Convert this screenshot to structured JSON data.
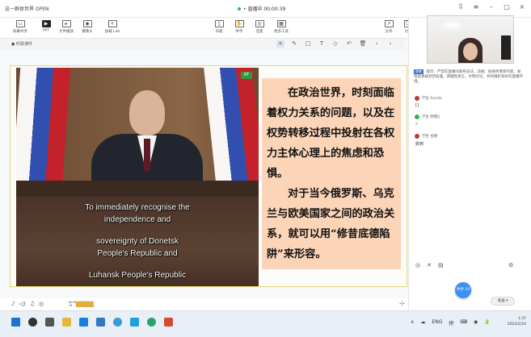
{
  "app": {
    "title": "这一群体世界 OPEN",
    "live_timer": "• 直播中 00:00:39"
  },
  "window_controls": {
    "layout_icon": "⠿",
    "list_icon": "≡",
    "minimize": "–",
    "maximize": "▢",
    "close": "×"
  },
  "toolbar": {
    "items": [
      {
        "icon": "monitor-icon",
        "glyph": "▭",
        "label": "屏幕共享"
      },
      {
        "icon": "slides-icon",
        "glyph": "▶",
        "label": "PPT"
      },
      {
        "icon": "video-icon",
        "glyph": "▸",
        "label": "文件播放"
      },
      {
        "icon": "camera-icon",
        "glyph": "◉",
        "label": "摄像头"
      },
      {
        "icon": "add-window-icon",
        "glyph": "+",
        "label": "加载 Lab"
      }
    ],
    "right_items": [
      {
        "icon": "whiteboard-icon",
        "glyph": "▯",
        "label": "白板"
      },
      {
        "icon": "hand-icon",
        "glyph": "✋",
        "label": "举手"
      },
      {
        "icon": "mic-icon",
        "glyph": "◎",
        "label": "连麦"
      },
      {
        "icon": "more-icon",
        "glyph": "▦",
        "label": "更多工具"
      }
    ],
    "far_right": [
      {
        "icon": "share-icon",
        "glyph": "↗",
        "label": "分享"
      },
      {
        "icon": "message-icon",
        "glyph": "☐",
        "label": "讨论"
      }
    ]
  },
  "drawbar": {
    "file_name": "● 时政课件",
    "tools": [
      "⌗",
      "✎",
      "□",
      "T",
      "◇",
      "↶",
      "🗑",
      "‹",
      "›"
    ]
  },
  "video": {
    "channel_logo": "RT",
    "subtitles": [
      "To immediately recognise the",
      "independence and",
      "",
      "sovereignty of Donetsk",
      "People's Republic and",
      "",
      "Luhansk People's Republic"
    ]
  },
  "slide_text": {
    "para1": "在政治世界，时刻面临着权力关系的问题，以及在权势转移过程中投射在各权力主体心理上的焦虑和恐惧。",
    "para2": "对于当今俄罗斯、乌克兰与欧美国家之间的政治关系，就可以用“修昔底德陷阱”来形容。"
  },
  "bottombar": {
    "controls": [
      "♪",
      "◁)",
      "♫",
      "◎"
    ],
    "thumb_label": "00:00:00\n2022-2-24"
  },
  "right_panel": {
    "chat_tag": "助教",
    "chat_message": "提示：严禁在直播间发布违法、违规、低俗色情等内容，发现后将被封禁处理。请理性发言，文明讨论，共同维护良好的直播环境。",
    "entries": [
      {
        "name": "学生 Sunda",
        "color": "#c0392b",
        "text": "[]"
      },
      {
        "name": "学生 明锦2",
        "color": "#2fb84f",
        "text": "√"
      },
      {
        "name": "学生 视频",
        "color": "#c0392b",
        "text": "收到"
      }
    ],
    "panel_icons": [
      "◎",
      "✕",
      "▤"
    ],
    "gear": "⚙",
    "fab_label": "举手 10",
    "send_label": "发送 ▾"
  },
  "taskbar": {
    "icon_colors": [
      "#1e73d2",
      "#333333",
      "#555555",
      "#e6b83a",
      "#1a7fd8",
      "#2f78c4",
      "#3a9ad9",
      "#1aa1e0",
      "#2aa36a",
      "#d64a2f"
    ],
    "tray": [
      "∧",
      "☁",
      "ENG",
      "拼",
      "⌨",
      "◉",
      "🔋"
    ],
    "time": "1:37",
    "date": "2022/2/24"
  }
}
